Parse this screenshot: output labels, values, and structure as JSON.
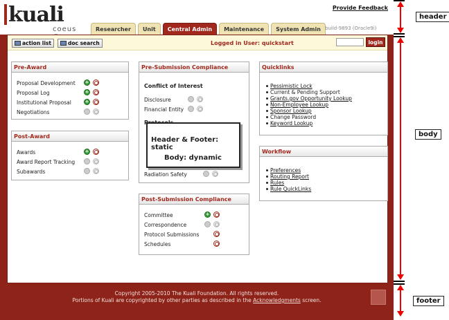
{
  "header": {
    "logo_text_k": "k",
    "logo_text_rest": "uali",
    "logo_sub": "coeus",
    "registered": "®",
    "feedback": "Provide Feedback",
    "tabs": [
      "Researcher",
      "Unit",
      "Central Admin",
      "Maintenance",
      "System Admin"
    ],
    "active_tab": "Central Admin",
    "build": "build-9893 (Oracle9i)"
  },
  "toolbar": {
    "action_list": "action list",
    "doc_search": "doc search",
    "logged_in": "Logged in User: quickstart",
    "login": "login"
  },
  "pre_award": {
    "title": "Pre-Award",
    "items": [
      "Proposal Development",
      "Proposal Log",
      "Institutional Proposal",
      "Negotiations"
    ]
  },
  "post_award": {
    "title": "Post-Award",
    "items": [
      "Awards",
      "Award Report Tracking",
      "Subawards"
    ]
  },
  "pre_submission": {
    "title": "Pre-Submission Compliance",
    "coi_title": "Conflict of Interest",
    "coi_items": [
      "Disclosure",
      "Financial Entity"
    ],
    "protocols_title": "Protocols",
    "radiation": "Radiation Safety"
  },
  "post_submission": {
    "title": "Post-Submission Compliance",
    "items": [
      "Committee",
      "Correspondence",
      "Protocol Submissions",
      "Schedules"
    ]
  },
  "quicklinks": {
    "title": "Quicklinks",
    "items": [
      "Pessimistic Lock",
      "Current & Pending Support",
      "Grants.gov Opportunity Lookup",
      "Non-Employee Lookup",
      "Sponsor Lookup",
      "Change Password",
      "Keyword Lookup"
    ]
  },
  "workflow": {
    "title": "Workflow",
    "items": [
      "Preferences",
      "Routing Report",
      "Rules",
      "Rule QuickLinks"
    ]
  },
  "callout": {
    "line1": "Header & Footer:  static",
    "line2": "Body:  dynamic"
  },
  "footer": {
    "line1": "Copyright 2005-2010 The Kuali Foundation. All rights reserved.",
    "line2_pre": "Portions of Kuali are copyrighted by other parties as described in the",
    "ack": "Acknowledgments",
    "line2_post": "screen."
  },
  "annotations": {
    "header": "header",
    "body": "body",
    "footer": "footer"
  },
  "colors": {
    "brand": "#a0281d",
    "accent_arrow": "#e00000",
    "toolbar_bg": "#fdf8da"
  }
}
